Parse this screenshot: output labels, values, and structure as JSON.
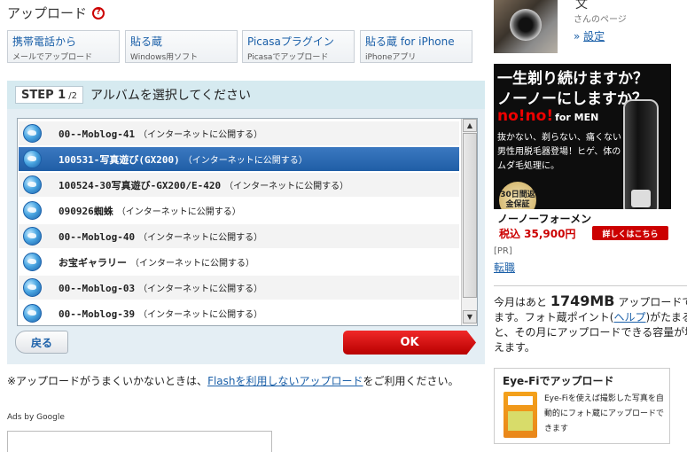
{
  "header": {
    "title": "アップロード",
    "help_glyph": "?"
  },
  "methods": [
    {
      "label": "携帯電話から",
      "sub": "メールでアップロード"
    },
    {
      "label": "貼る蔵",
      "sub": "Windows用ソフト"
    },
    {
      "label": "Picasaプラグイン",
      "sub": "Picasaでアップロード"
    },
    {
      "label": "貼る蔵 for iPhone",
      "sub": "iPhoneアプリ"
    }
  ],
  "step": {
    "badge": "STEP 1",
    "fraction": "/2",
    "title": "アルバムを選択してください"
  },
  "albums": [
    {
      "name": "00--Moblog-41",
      "note": "（インターネットに公開する）",
      "selected": false
    },
    {
      "name": "100531-写真遊び(GX200)",
      "note": "（インターネットに公開する）",
      "selected": true
    },
    {
      "name": "100524-30写真遊び-GX200/E-420",
      "note": "（インターネットに公開する）",
      "selected": false
    },
    {
      "name": "090926蜘蛛",
      "note": "（インターネットに公開する）",
      "selected": false
    },
    {
      "name": "00--Moblog-40",
      "note": "（インターネットに公開する）",
      "selected": false
    },
    {
      "name": "お宝ギャラリー",
      "note": "（インターネットに公開する）",
      "selected": false
    },
    {
      "name": "00--Moblog-03",
      "note": "（インターネットに公開する）",
      "selected": false
    },
    {
      "name": "00--Moblog-39",
      "note": "（インターネットに公開する）",
      "selected": false
    }
  ],
  "buttons": {
    "back": "戻る",
    "ok": "OK"
  },
  "scrollbar": {
    "up": "▲",
    "down": "▼"
  },
  "notice": {
    "prefix": "※アップロードがうまくいかないときは、",
    "link": "Flashを利用しないアップロード",
    "suffix": "をご利用ください。"
  },
  "ads": {
    "label": "Ads by Google"
  },
  "user": {
    "name": "文",
    "page_label": "さんのページ",
    "settings_prefix": "» ",
    "settings_link": "設定"
  },
  "banner": {
    "line1": "一生剃り続けますか？",
    "line2": "ノーノーにしますか？",
    "brand_red": "no!no!",
    "brand_suffix": "for MEN",
    "body": "抜かない、剃らない、痛くない男性用脱毛器登場！ヒゲ、体のムダ毛処理に。",
    "guarantee": "30日間返金保証",
    "product": "ノーノーフォーメン",
    "price": "税込 35,900円",
    "cta": "詳しくはこちら"
  },
  "sidebar": {
    "pr_label": "[PR]",
    "reprint_link": "転職"
  },
  "quota": {
    "prefix": "今月はあと",
    "amount": "1749MB",
    "suffix": "アップロードできます。フォト蔵ポイント(",
    "help_link": "ヘルプ",
    "rest": ")がたまると、その月にアップロードできる容量が増えます。",
    "line1_tail": "アップロードでき",
    "line2": "ます。フォト蔵ポイント(",
    "line2_tail": ")がたまる",
    "line3": "と、その月にアップロードできる容量が増",
    "line4": "えます。"
  },
  "eyefi": {
    "title": "Eye-Fiでアップロード",
    "desc": "Eye-Fiを使えば撮影した写真を自動的にフォト蔵にアップロードできます"
  },
  "colors": {
    "link": "#1a5fa8",
    "ok_button": "#d40000",
    "selected_row": "#2a69b2",
    "step_header": "#d6eaf0"
  }
}
